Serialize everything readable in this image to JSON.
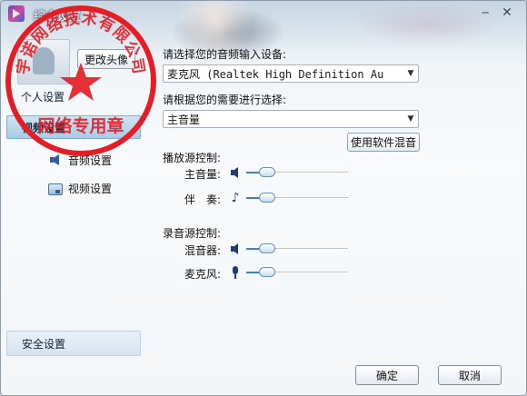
{
  "window": {
    "title": "综合设置"
  },
  "titlebar": {
    "minimize_glyph": "─",
    "close_glyph": "✕"
  },
  "sidebar": {
    "change_avatar_label": "更改头像",
    "personal_settings": "个人设置",
    "video_settings_group": "视频设置",
    "audio_settings": "音频设置",
    "video_settings": "视频设置",
    "security_settings": "安全设置"
  },
  "content": {
    "input_device_prompt": "请选择您的音频输入设备:",
    "input_device_value": "麦克风 (Realtek High Definition Au",
    "mode_prompt": "请根据您的需要进行选择:",
    "mode_value": "主音量",
    "software_mix_label": "使用软件混音",
    "playback_section": "播放源控制:",
    "recording_section": "录音源控制:",
    "sliders": [
      {
        "label": "主音量:",
        "icon": "speaker-icon",
        "level": 0.15
      },
      {
        "label": "伴　奏:",
        "icon": "music-note-icon",
        "level": 0.15
      },
      {
        "label": "混音器:",
        "icon": "speaker-icon",
        "level": 0.15
      },
      {
        "label": "麦克风:",
        "icon": "microphone-icon",
        "level": 0.15
      }
    ]
  },
  "footer": {
    "ok_label": "确定",
    "cancel_label": "取消"
  },
  "seal": {
    "text": "宇诺网络技术有限公司",
    "subtext": "网络专用章",
    "color": "#e41e26"
  },
  "colors": {
    "accent": "#3a7fc8",
    "nav_selected": "#a8cbe6"
  }
}
